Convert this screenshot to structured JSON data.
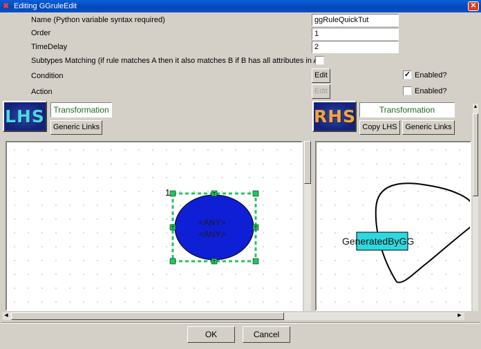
{
  "window": {
    "title": "Editing GGruleEdit",
    "close_glyph": "✕"
  },
  "form": {
    "name_label": "Name (Python variable syntax required)",
    "name_value": "ggRuleQuickTut",
    "order_label": "Order",
    "order_value": "1",
    "timedelay_label": "TimeDelay",
    "timedelay_value": "2",
    "subtypes_label": "Subtypes Matching (if rule matches A then it also matches B if B has all attributes in A)",
    "subtypes_checked": false,
    "condition_label": "Condition",
    "condition_edit": "Edit",
    "condition_enabled_label": "Enabled?",
    "condition_enabled_checked": true,
    "action_label": "Action",
    "action_edit": "Edit",
    "action_enabled_label": "Enabled?",
    "action_enabled_checked": false
  },
  "lhs": {
    "logo_text": "LHS",
    "transformation_label": "Transformation",
    "generic_links_button": "Generic Links",
    "node": {
      "index": "1",
      "line1": "<ANY>",
      "line2": "<ANY>",
      "fill_color": "#0f1fd6",
      "handle_color": "#22c55e",
      "handle_glyph": "T"
    }
  },
  "rhs": {
    "logo_text": "RHS",
    "transformation_label": "Transformation",
    "copy_lhs_button": "Copy LHS",
    "generic_links_button": "Generic Links",
    "node": {
      "label": "GeneratedByGG",
      "highlight_color": "#2fd8e0"
    }
  },
  "buttons": {
    "ok": "OK",
    "cancel": "Cancel"
  },
  "colors": {
    "title_bar": "#0a5fd6",
    "dialog_bg": "#d4d0c8",
    "grid_dot": "#bdbdbd"
  },
  "icons": {
    "title": "app-icon",
    "close": "close-icon",
    "check": "checkmark-icon"
  }
}
